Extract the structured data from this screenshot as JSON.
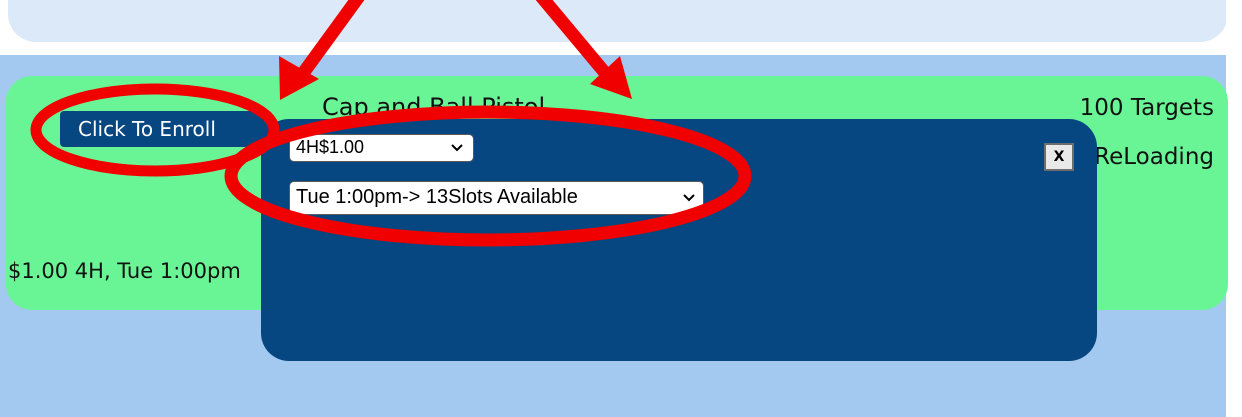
{
  "card": {
    "title": "Cap and Ball Pistol",
    "targets": "100 Targets",
    "reloading": "ReLoading",
    "summary": "$1.00 4H, Tue 1:00pm"
  },
  "enroll_button": {
    "label": "Click To Enroll"
  },
  "modal": {
    "price_select": {
      "value": "4H$1.00"
    },
    "slot_select": {
      "value": "Tue 1:00pm-> 13Slots Available"
    },
    "close_label": "X"
  },
  "colors": {
    "page_blue": "#a4c9f1",
    "card_green": "#69f596",
    "modal_navy": "#064681",
    "annotation_red": "#f10000"
  },
  "icons": {
    "dropdown": "chevron-down-icon"
  }
}
